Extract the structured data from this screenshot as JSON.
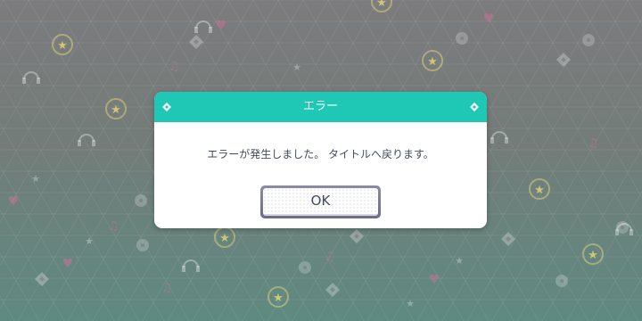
{
  "dialog": {
    "title": "エラー",
    "message": "エラーが発生しました。 タイトルへ戻ります。",
    "ok_label": "OK"
  },
  "colors": {
    "header": "#1fc8b5",
    "text": "#444a5e",
    "button_border": "#7a7a96"
  },
  "icons": [
    "diamond-icon",
    "star-badge-icon",
    "headphones-icon",
    "heart-icon",
    "music-note-icon",
    "cd-icon"
  ]
}
